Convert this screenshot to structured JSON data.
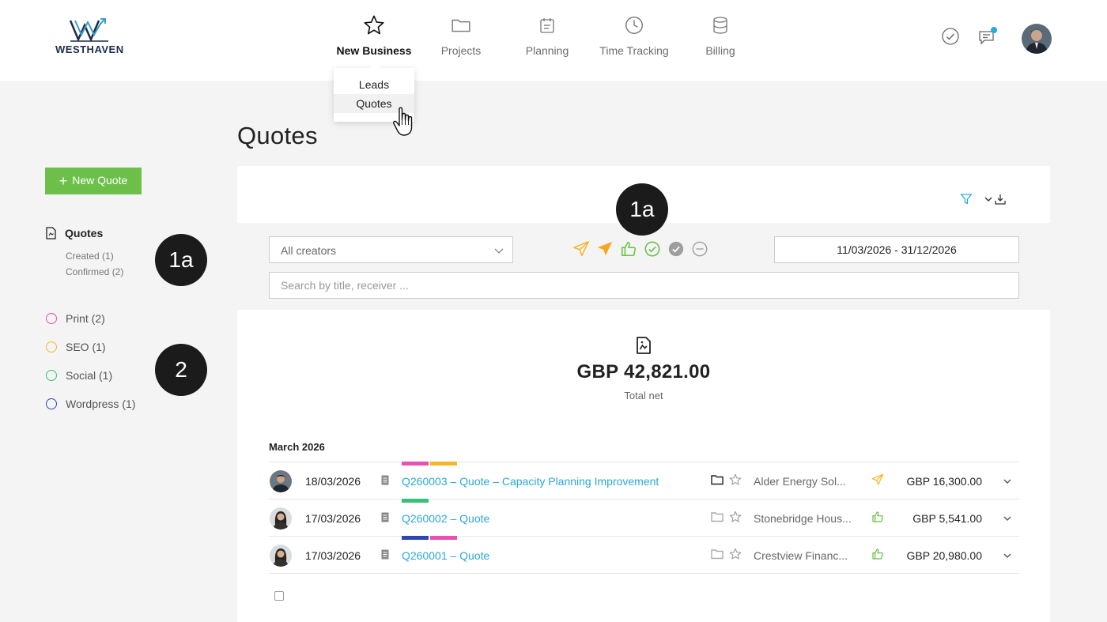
{
  "brand": {
    "name": "WESTHAVEN"
  },
  "nav": {
    "items": [
      {
        "label": "New Business",
        "icon": "star-icon",
        "active": true
      },
      {
        "label": "Projects",
        "icon": "folder-icon"
      },
      {
        "label": "Planning",
        "icon": "calendar-icon"
      },
      {
        "label": "Time Tracking",
        "icon": "clock-icon"
      },
      {
        "label": "Billing",
        "icon": "database-icon"
      }
    ],
    "dropdown": [
      {
        "label": "Leads"
      },
      {
        "label": "Quotes"
      }
    ]
  },
  "header_icons": [
    "check-circle-icon",
    "chat-icon",
    "user-avatar"
  ],
  "page": {
    "title": "Quotes"
  },
  "sidebar": {
    "new_button": "New Quote",
    "section_title": "Quotes",
    "sub_items": [
      {
        "label": "Created (1)"
      },
      {
        "label": "Confirmed (2)"
      }
    ],
    "tags": [
      {
        "label": "Print (2)",
        "color": "#e94fb4"
      },
      {
        "label": "SEO (1)",
        "color": "#f5b62c"
      },
      {
        "label": "Social (1)",
        "color": "#38c07a"
      },
      {
        "label": "Wordpress (1)",
        "color": "#2c48b8"
      }
    ]
  },
  "badges": [
    {
      "label": "1a"
    },
    {
      "label": "1a"
    },
    {
      "label": "2"
    }
  ],
  "filters": {
    "creator_select": "All creators",
    "date_range": "11/03/2026 - 31/12/2026",
    "search_placeholder": "Search by title, receiver ...",
    "status_icons": [
      {
        "name": "send-outline-icon",
        "color": "#f5b62c"
      },
      {
        "name": "send-filled-icon",
        "color": "#f5a623"
      },
      {
        "name": "thumbs-up-icon",
        "color": "#6cc04a"
      },
      {
        "name": "check-circle-icon",
        "color": "#6cc04a"
      },
      {
        "name": "check-filled-icon",
        "color": "#9e9e9e"
      },
      {
        "name": "minus-circle-icon",
        "color": "#9e9e9e"
      }
    ]
  },
  "summary": {
    "total": "GBP 42,821.00",
    "label": "Total net"
  },
  "group": {
    "month": "March 2026"
  },
  "quotes": [
    {
      "date": "18/03/2026",
      "title": "Q260003 – Quote – Capacity Planning Improvement",
      "client": "Alder Energy Sol...",
      "amount": "GBP 16,300.00",
      "status": "send-outline-icon",
      "tags": [
        "#e94fb4",
        "#f5b62c"
      ],
      "folder_dark": true
    },
    {
      "date": "17/03/2026",
      "title": "Q260002 – Quote",
      "client": "Stonebridge Hous...",
      "amount": "GBP 5,541.00",
      "status": "thumbs-up-icon",
      "tags": [
        "#38c07a"
      ],
      "folder_dark": false
    },
    {
      "date": "17/03/2026",
      "title": "Q260001 – Quote",
      "client": "Crestview Financ...",
      "amount": "GBP 20,980.00",
      "status": "thumbs-up-icon",
      "tags": [
        "#2c48b8",
        "#e94fb4"
      ],
      "folder_dark": false
    }
  ]
}
